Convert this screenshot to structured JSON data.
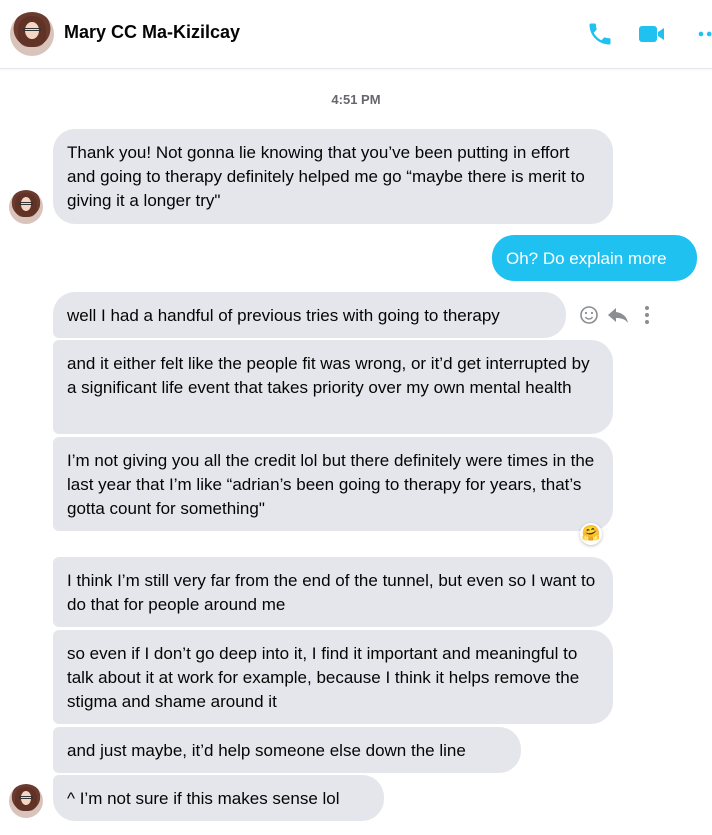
{
  "header": {
    "contact_name": "Mary CC Ma-Kizilcay",
    "icons": [
      "call-icon",
      "video-icon",
      "more-icon"
    ],
    "accent_color": "#1fc1f0"
  },
  "timestamp": "4:51 PM",
  "messages": [
    {
      "from": "them",
      "text": "Thank you! Not gonna lie knowing that you’ve been putting in effort and going to therapy definitely helped me go “maybe there is merit to giving it a longer try\""
    },
    {
      "from": "me",
      "text": "Oh? Do explain more"
    },
    {
      "from": "them",
      "text": "well I had a handful of previous tries with going to therapy"
    },
    {
      "from": "them",
      "text": "and it either felt like the people fit was wrong, or it’d get interrupted by a significant life event that takes priority over my own mental health"
    },
    {
      "from": "them",
      "text": "I’m not giving you all the credit lol but there definitely were times in the last year that I’m like “adrian’s been going to therapy for years, that’s gotta count for something\""
    },
    {
      "from": "them",
      "text": "I think I’m still very far from the end of the tunnel, but even so I want to do that for people around me"
    },
    {
      "from": "them",
      "text": "so even if I don’t go deep into it, I find it important and meaningful to talk about it at work for example, because I think it helps remove the stigma and shame around it"
    },
    {
      "from": "them",
      "text": "and just maybe, it’d help someone else down the line"
    },
    {
      "from": "them",
      "text": "^ I’m not sure if this makes sense lol"
    }
  ],
  "reaction": "🤗",
  "message_actions": [
    "react-icon",
    "reply-icon",
    "more-options-icon"
  ]
}
